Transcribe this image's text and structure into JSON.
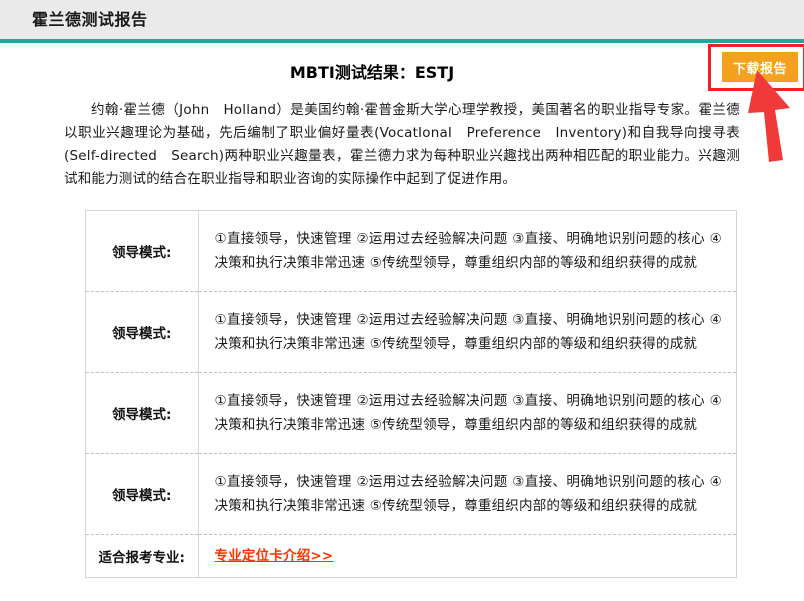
{
  "header": {
    "title": "霍兰德测试报告",
    "bar_color": "#eaeaea",
    "accent_color": "#26a69a"
  },
  "result": {
    "title": "MBTI测试结果：ESTJ"
  },
  "download": {
    "label": "下载报告",
    "button_color": "#f5a120",
    "highlight_color": "#f22222",
    "arrow_color": "#f03a3a"
  },
  "intro": {
    "text": "约翰·霍兰德（John　Holland）是美国约翰·霍普金斯大学心理学教授，美国著名的职业指导专家。霍兰德以职业兴趣理论为基础，先后编制了职业偏好量表(VocatIonaI　Preference　Inventory)和自我导向搜寻表(Self-directed　Search)两种职业兴趣量表，霍兰德力求为每种职业兴趣找出两种相匹配的职业能力。兴趣测试和能力测试的结合在职业指导和职业咨询的实际操作中起到了促进作用。"
  },
  "report_table": {
    "rows": [
      {
        "label": "领导模式:",
        "value": "①直接领导，快速管理 ②运用过去经验解决问题 ③直接、明确地识别问题的核心 ④决策和执行决策非常迅速 ⑤传统型领导，尊重组织内部的等级和组织获得的成就",
        "kind": "text"
      },
      {
        "label": "领导模式:",
        "value": "①直接领导，快速管理 ②运用过去经验解决问题 ③直接、明确地识别问题的核心 ④决策和执行决策非常迅速 ⑤传统型领导，尊重组织内部的等级和组织获得的成就",
        "kind": "text"
      },
      {
        "label": "领导模式:",
        "value": "①直接领导，快速管理 ②运用过去经验解决问题 ③直接、明确地识别问题的核心 ④决策和执行决策非常迅速 ⑤传统型领导，尊重组织内部的等级和组织获得的成就",
        "kind": "text"
      },
      {
        "label": "领导模式:",
        "value": "①直接领导，快速管理 ②运用过去经验解决问题 ③直接、明确地识别问题的核心 ④决策和执行决策非常迅速 ⑤传统型领导，尊重组织内部的等级和组织获得的成就",
        "kind": "text"
      },
      {
        "label": "适合报考专业:",
        "value": "专业定位卡介绍>>",
        "kind": "link"
      }
    ]
  }
}
